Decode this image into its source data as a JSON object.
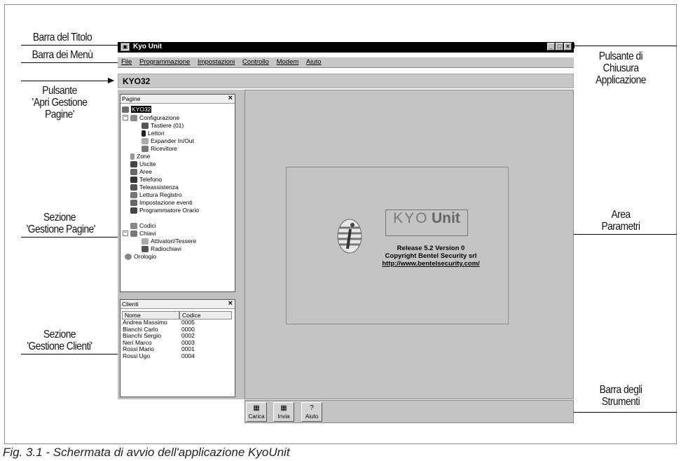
{
  "annotations": {
    "title_bar": "Barra del Titolo",
    "menu_bar": "Barra dei Menù",
    "open_pages_button": [
      "Pulsante",
      "'Apri Gestione",
      "Pagine'"
    ],
    "pages_section": [
      "Sezione",
      "'Gestione Pagine'"
    ],
    "clients_section": [
      "Sezione",
      "'Gestione Clienti'"
    ],
    "close_button": [
      "Pulsante di",
      "Chiusura",
      "Applicazione"
    ],
    "params_area": [
      "Area",
      "Parametri"
    ],
    "toolbar": [
      "Barra degli",
      "Strumenti"
    ]
  },
  "caption": "Fig. 3.1 - Schermata di avvio dell'applicazione KyoUnit",
  "window": {
    "title": "Kyo Unit",
    "menu": [
      "File",
      "Programmazione",
      "Impostazioni",
      "Controllo",
      "Modem",
      "Aiuto"
    ],
    "session": "KYO32"
  },
  "pages_panel": {
    "title": "Pagine",
    "close": "×",
    "root": "KYO32",
    "configurazione": "Configurazione",
    "config_children": [
      "Tastiere (01)",
      "Lettori",
      "Expander In/Out",
      "Ricevitore"
    ],
    "items": [
      "Zone",
      "Uscite",
      "Aree",
      "Telefono",
      "Teleassistenza",
      "Lettura Registro",
      "Impostazione eventi",
      "Programmatore Orario",
      "Codici"
    ],
    "chiavi": "Chiavi",
    "chiavi_children": [
      "Attivatori/Tessere",
      "Radiochiavi"
    ],
    "orologio": "Orologio"
  },
  "clients_panel": {
    "title": "Clienti",
    "close": "×",
    "headers": [
      "Nome",
      "Codice"
    ],
    "rows": [
      [
        "Andrea Massimo",
        "0005"
      ],
      [
        "Bianchi Carlo",
        "0000"
      ],
      [
        "Bianchi Sergio",
        "0002"
      ],
      [
        "Neri Marco",
        "0003"
      ],
      [
        "Rossi Mario",
        "0001"
      ],
      [
        "Rossi Ugo",
        "0004"
      ]
    ]
  },
  "about": {
    "logo_thin": "KYO",
    "logo_bold": "Unit",
    "release": "Release 5.2 Version 0",
    "copyright": "Copyright Bentel Security srl",
    "url": "http://www.bentelsecurity.com/"
  },
  "toolbar_buttons": [
    "Carica",
    "Invia",
    "Aiuto"
  ],
  "toolbar_glyphs": [
    "▦",
    "▦",
    "?"
  ]
}
